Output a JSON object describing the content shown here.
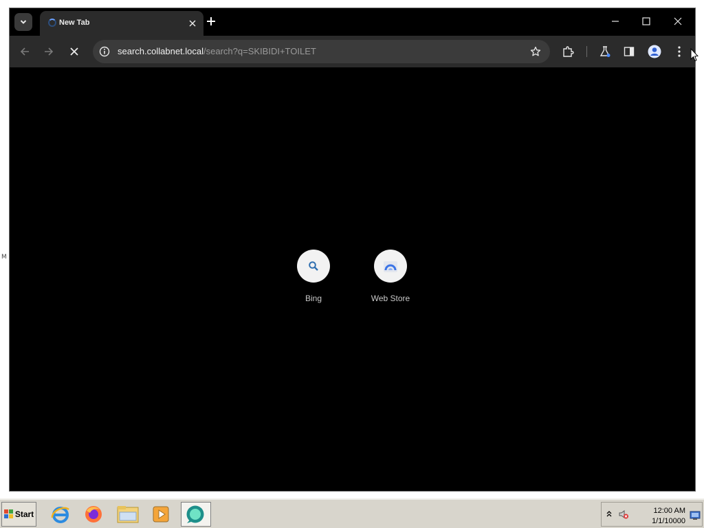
{
  "browser": {
    "tab": {
      "title": "New Tab"
    },
    "omnibox": {
      "host": "search.collabnet.local",
      "path": "/search?q=SKIBIDI+TOILET"
    }
  },
  "shortcuts": [
    {
      "label": "Bing",
      "icon": "search-icon"
    },
    {
      "label": "Web Store",
      "icon": "web-store-icon"
    }
  ],
  "taskbar": {
    "start_label": "Start",
    "apps": [
      "internet-explorer-icon",
      "firefox-icon",
      "file-explorer-icon",
      "media-player-icon",
      "browser-icon"
    ],
    "clock": {
      "time": "12:00 AM",
      "date": "1/1/10000"
    }
  },
  "colors": {
    "content_bg": "#000000",
    "toolbar_bg": "#2b2b2b",
    "taskbar_bg": "#d8d5cc"
  }
}
